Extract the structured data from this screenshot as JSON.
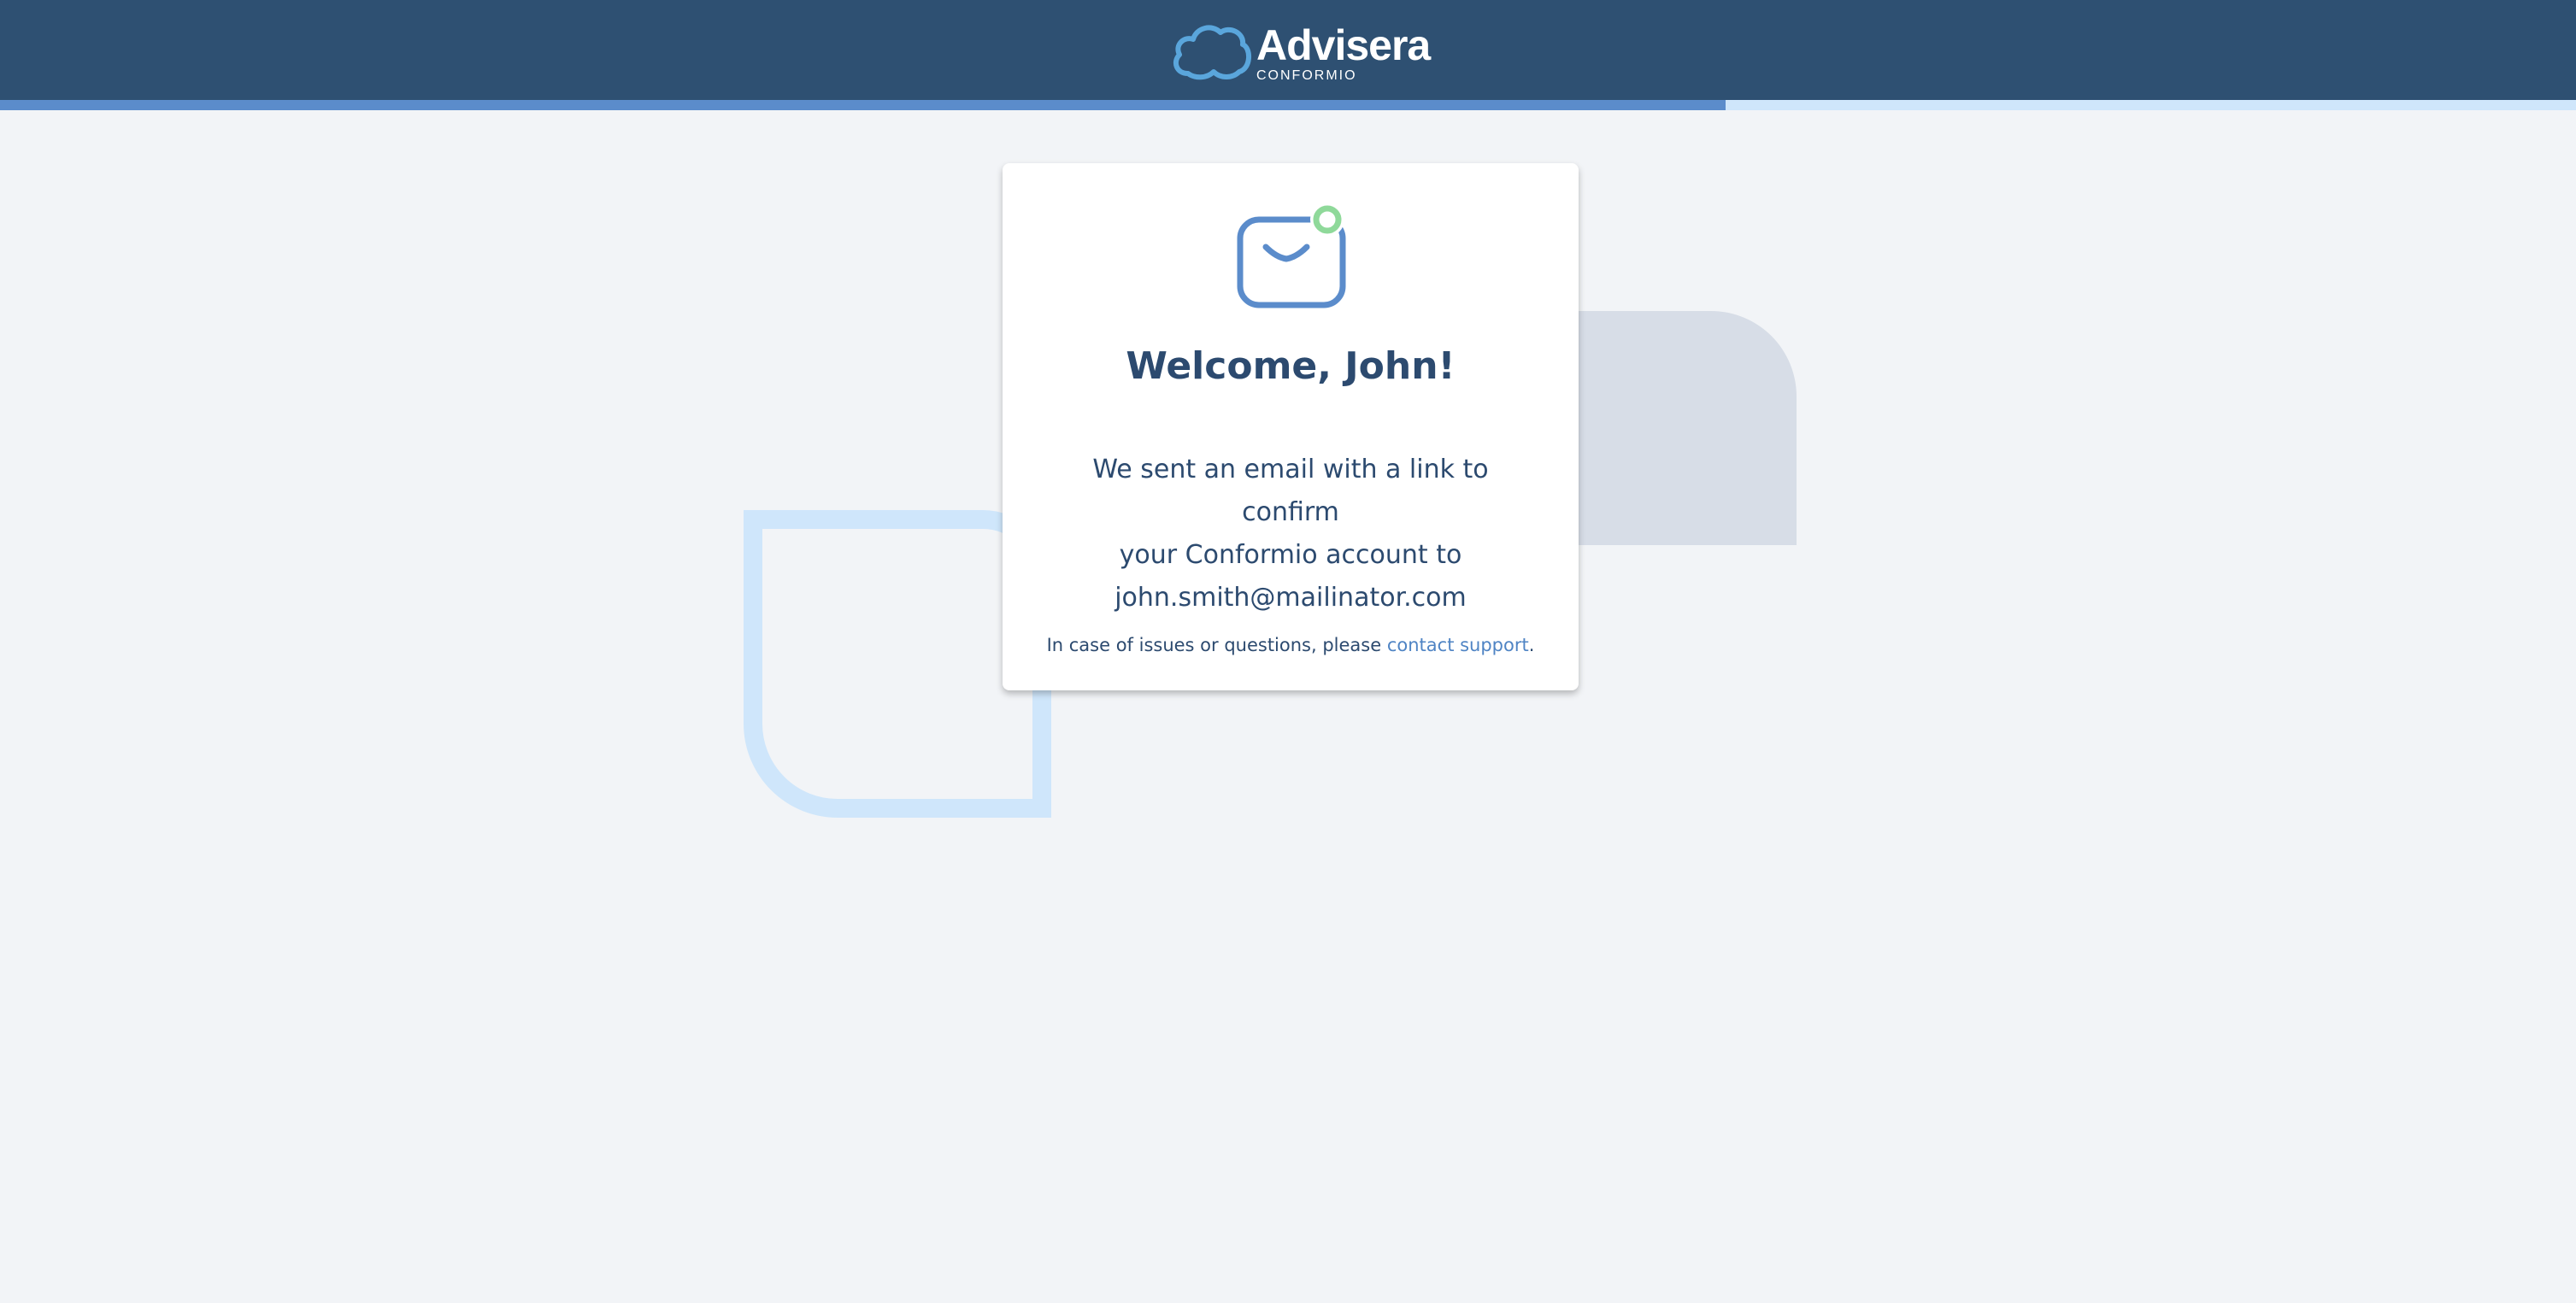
{
  "header": {
    "logo": {
      "name": "Advisera",
      "subtitle": "CONFORMIO",
      "icon": "cloud-logo-icon"
    },
    "background_color": "#2e5072",
    "progress": {
      "value_percent": 67,
      "fill_color": "#5b8ccb",
      "track_color": "#cfe6fb"
    }
  },
  "card": {
    "icon": "mail-notification-icon",
    "title": "Welcome, John!",
    "message_lines": [
      "We sent an email with a link to confirm",
      "your Conformio account to",
      "john.smith@mailinator.com"
    ],
    "footer_text": "In case of issues or questions, please ",
    "footer_link": "contact support",
    "footer_end": "."
  },
  "colors": {
    "page_background": "#f2f4f7",
    "text": "#2c4a6f",
    "link": "#4f84c4",
    "icon_blue": "#5b8ccb",
    "icon_green": "#8fd99a"
  }
}
